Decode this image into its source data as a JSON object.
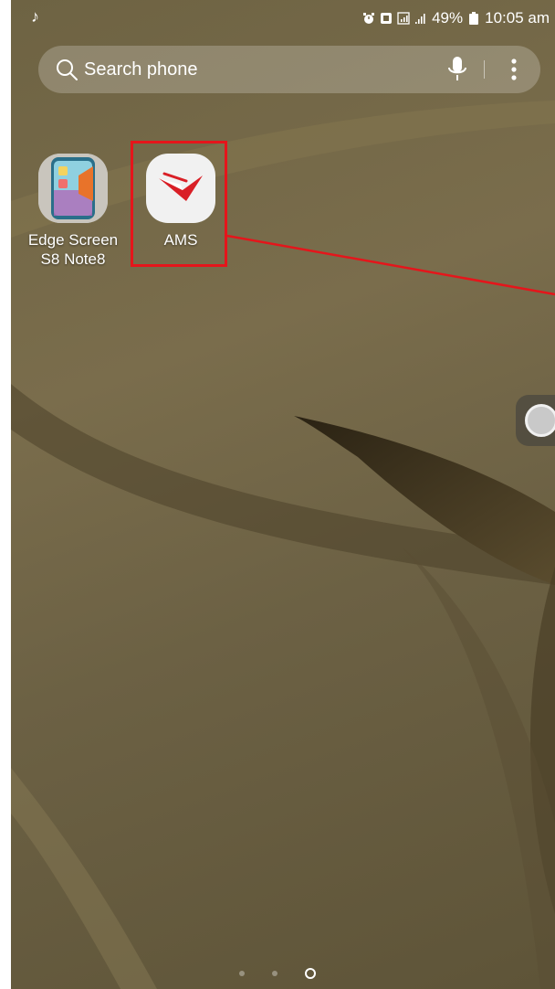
{
  "status_bar": {
    "left_icons": [
      "music-icon"
    ],
    "right_icons": [
      "alarm-icon",
      "nfc-icon",
      "signal-box-icon",
      "signal-bars-icon"
    ],
    "battery": "49%",
    "time": "10:05 am"
  },
  "search": {
    "placeholder": "Search phone",
    "icons": [
      "search-icon",
      "mic-icon",
      "more-vertical-icon"
    ]
  },
  "apps": [
    {
      "label_line1": "Edge Screen",
      "label_line2": "S8 Note8",
      "icon": "edge-screen-app-icon"
    },
    {
      "label_line1": "AMS",
      "label_line2": "",
      "icon": "ams-app-icon"
    }
  ],
  "annotation": {
    "color": "#e5151b"
  },
  "page_indicator": {
    "pages": 3,
    "current_page": 3
  },
  "colors": {
    "accent_red": "#e5151b",
    "wallpaper": "#6e6343"
  }
}
